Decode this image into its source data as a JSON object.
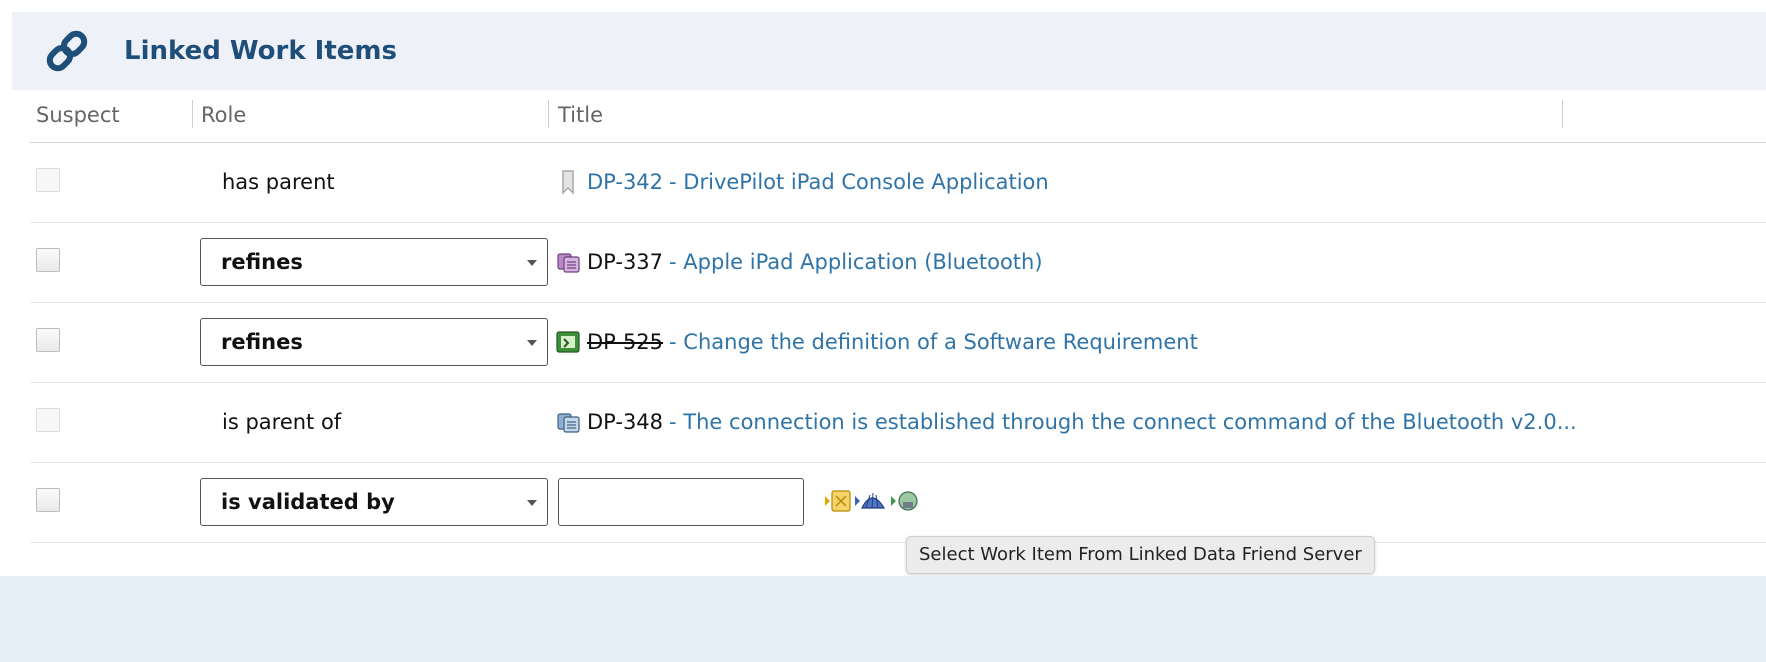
{
  "panel": {
    "title": "Linked Work Items",
    "icon": "link-icon"
  },
  "columns": {
    "suspect": "Suspect",
    "role": "Role",
    "title": "Title"
  },
  "rows": [
    {
      "suspect_disabled": true,
      "role": "has parent",
      "role_editable": false,
      "icon": "bookmark-icon",
      "id": "DP-342",
      "id_style": "link",
      "title": "- DrivePilot iPad Console Application"
    },
    {
      "suspect_disabled": false,
      "role": "refines",
      "role_editable": true,
      "icon": "requirement-stack-icon",
      "id": "DP-337",
      "id_style": "plain",
      "title": "- Apple iPad Application (Bluetooth)"
    },
    {
      "suspect_disabled": false,
      "role": "refines",
      "role_editable": true,
      "icon": "change-request-icon",
      "id": "DP-525",
      "id_style": "struck",
      "title": "- Change the definition of a Software Requirement"
    },
    {
      "suspect_disabled": true,
      "role": "is parent of",
      "role_editable": false,
      "icon": "requirement-stack-icon",
      "id": "DP-348",
      "id_style": "plain",
      "title": "- The connection is established through the connect command of the Bluetooth v2.0..."
    }
  ],
  "new_link": {
    "role": "is validated by",
    "input_value": ""
  },
  "tooltip": "Select Work Item From Linked Data Friend Server",
  "colors": {
    "header_bg": "#eef1f8",
    "title_color": "#1f4e79",
    "link_color": "#2f74a8"
  }
}
